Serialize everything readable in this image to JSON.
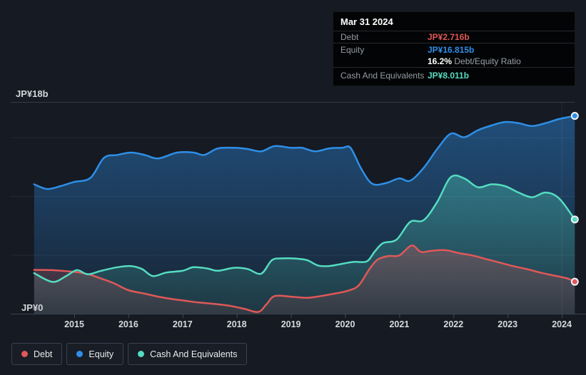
{
  "tooltip": {
    "date": "Mar 31 2024",
    "debt_label": "Debt",
    "debt_value": "JP¥2.716b",
    "equity_label": "Equity",
    "equity_value": "JP¥16.815b",
    "ratio_value": "16.2%",
    "ratio_label": "Debt/Equity Ratio",
    "cash_label": "Cash And Equivalents",
    "cash_value": "JP¥8.011b"
  },
  "legend": {
    "items": [
      {
        "label": "Debt",
        "color": "#e05858"
      },
      {
        "label": "Equity",
        "color": "#2f8fe6"
      },
      {
        "label": "Cash And Equivalents",
        "color": "#55dcc0"
      }
    ]
  },
  "chart_data": {
    "type": "area",
    "unit_prefix": "JP¥",
    "unit_suffix": "b",
    "y_axis": {
      "top_label": "JP¥18b",
      "bottom_label": "JP¥0",
      "ylim": [
        0,
        18
      ],
      "gridline_values": [
        18,
        15,
        10,
        5,
        0
      ]
    },
    "x_axis": {
      "ticks": [
        2015,
        2016,
        2017,
        2018,
        2019,
        2020,
        2021,
        2022,
        2023,
        2024
      ]
    },
    "x_domain": [
      2014.26,
      2024.24
    ],
    "hover_x": 2024,
    "series": [
      {
        "name": "Debt",
        "color": "#e05858",
        "points": [
          [
            2014.26,
            3.72
          ],
          [
            2014.6,
            3.7
          ],
          [
            2014.9,
            3.6
          ],
          [
            2015.1,
            3.5
          ],
          [
            2015.3,
            3.3
          ],
          [
            2015.55,
            2.9
          ],
          [
            2015.75,
            2.55
          ],
          [
            2016.0,
            2.0
          ],
          [
            2016.3,
            1.7
          ],
          [
            2016.55,
            1.45
          ],
          [
            2016.8,
            1.25
          ],
          [
            2017.05,
            1.1
          ],
          [
            2017.3,
            0.95
          ],
          [
            2017.65,
            0.8
          ],
          [
            2017.9,
            0.65
          ],
          [
            2018.15,
            0.4
          ],
          [
            2018.4,
            0.15
          ],
          [
            2018.55,
            0.8
          ],
          [
            2018.7,
            1.5
          ],
          [
            2019.0,
            1.45
          ],
          [
            2019.3,
            1.35
          ],
          [
            2019.55,
            1.5
          ],
          [
            2019.8,
            1.7
          ],
          [
            2020.05,
            1.95
          ],
          [
            2020.25,
            2.4
          ],
          [
            2020.45,
            3.8
          ],
          [
            2020.6,
            4.6
          ],
          [
            2020.8,
            4.9
          ],
          [
            2021.0,
            4.95
          ],
          [
            2021.23,
            5.8
          ],
          [
            2021.4,
            5.25
          ],
          [
            2021.6,
            5.35
          ],
          [
            2021.85,
            5.4
          ],
          [
            2022.1,
            5.15
          ],
          [
            2022.35,
            4.95
          ],
          [
            2022.6,
            4.65
          ],
          [
            2022.85,
            4.35
          ],
          [
            2023.1,
            4.05
          ],
          [
            2023.35,
            3.8
          ],
          [
            2023.6,
            3.5
          ],
          [
            2023.85,
            3.25
          ],
          [
            2024.1,
            3.0
          ],
          [
            2024.24,
            2.716
          ]
        ]
      },
      {
        "name": "Equity",
        "color": "#2f8fe6",
        "points": [
          [
            2014.26,
            11.0
          ],
          [
            2014.5,
            10.6
          ],
          [
            2014.75,
            10.85
          ],
          [
            2015.0,
            11.2
          ],
          [
            2015.3,
            11.55
          ],
          [
            2015.55,
            13.25
          ],
          [
            2015.8,
            13.5
          ],
          [
            2016.05,
            13.7
          ],
          [
            2016.3,
            13.5
          ],
          [
            2016.55,
            13.2
          ],
          [
            2016.9,
            13.7
          ],
          [
            2017.2,
            13.7
          ],
          [
            2017.4,
            13.5
          ],
          [
            2017.65,
            14.05
          ],
          [
            2017.95,
            14.1
          ],
          [
            2018.2,
            14.0
          ],
          [
            2018.45,
            13.8
          ],
          [
            2018.7,
            14.25
          ],
          [
            2019.0,
            14.1
          ],
          [
            2019.2,
            14.1
          ],
          [
            2019.45,
            13.8
          ],
          [
            2019.7,
            14.05
          ],
          [
            2019.95,
            14.1
          ],
          [
            2020.1,
            14.1
          ],
          [
            2020.3,
            12.3
          ],
          [
            2020.5,
            11.05
          ],
          [
            2020.75,
            11.1
          ],
          [
            2021.0,
            11.5
          ],
          [
            2021.2,
            11.3
          ],
          [
            2021.45,
            12.4
          ],
          [
            2021.7,
            14.0
          ],
          [
            2021.95,
            15.3
          ],
          [
            2022.2,
            15.0
          ],
          [
            2022.45,
            15.6
          ],
          [
            2022.7,
            16.0
          ],
          [
            2022.95,
            16.3
          ],
          [
            2023.2,
            16.2
          ],
          [
            2023.45,
            15.95
          ],
          [
            2023.7,
            16.2
          ],
          [
            2023.95,
            16.55
          ],
          [
            2024.24,
            16.815
          ]
        ]
      },
      {
        "name": "Cash And Equivalents",
        "color": "#55dcc0",
        "points": [
          [
            2014.26,
            3.45
          ],
          [
            2014.6,
            2.7
          ],
          [
            2014.85,
            3.2
          ],
          [
            2015.05,
            3.7
          ],
          [
            2015.25,
            3.35
          ],
          [
            2015.5,
            3.65
          ],
          [
            2015.8,
            3.95
          ],
          [
            2016.05,
            4.05
          ],
          [
            2016.25,
            3.8
          ],
          [
            2016.45,
            3.2
          ],
          [
            2016.7,
            3.5
          ],
          [
            2017.0,
            3.65
          ],
          [
            2017.2,
            3.95
          ],
          [
            2017.45,
            3.85
          ],
          [
            2017.65,
            3.65
          ],
          [
            2017.95,
            3.9
          ],
          [
            2018.2,
            3.8
          ],
          [
            2018.45,
            3.4
          ],
          [
            2018.65,
            4.55
          ],
          [
            2018.85,
            4.7
          ],
          [
            2019.1,
            4.68
          ],
          [
            2019.3,
            4.55
          ],
          [
            2019.5,
            4.1
          ],
          [
            2019.7,
            4.05
          ],
          [
            2019.9,
            4.2
          ],
          [
            2020.15,
            4.4
          ],
          [
            2020.4,
            4.45
          ],
          [
            2020.55,
            5.3
          ],
          [
            2020.7,
            6.0
          ],
          [
            2020.95,
            6.3
          ],
          [
            2021.2,
            7.8
          ],
          [
            2021.45,
            7.95
          ],
          [
            2021.7,
            9.5
          ],
          [
            2021.95,
            11.6
          ],
          [
            2022.2,
            11.5
          ],
          [
            2022.45,
            10.75
          ],
          [
            2022.7,
            11.0
          ],
          [
            2022.95,
            10.85
          ],
          [
            2023.2,
            10.3
          ],
          [
            2023.45,
            9.9
          ],
          [
            2023.7,
            10.3
          ],
          [
            2023.95,
            9.8
          ],
          [
            2024.24,
            8.011
          ]
        ]
      }
    ]
  }
}
